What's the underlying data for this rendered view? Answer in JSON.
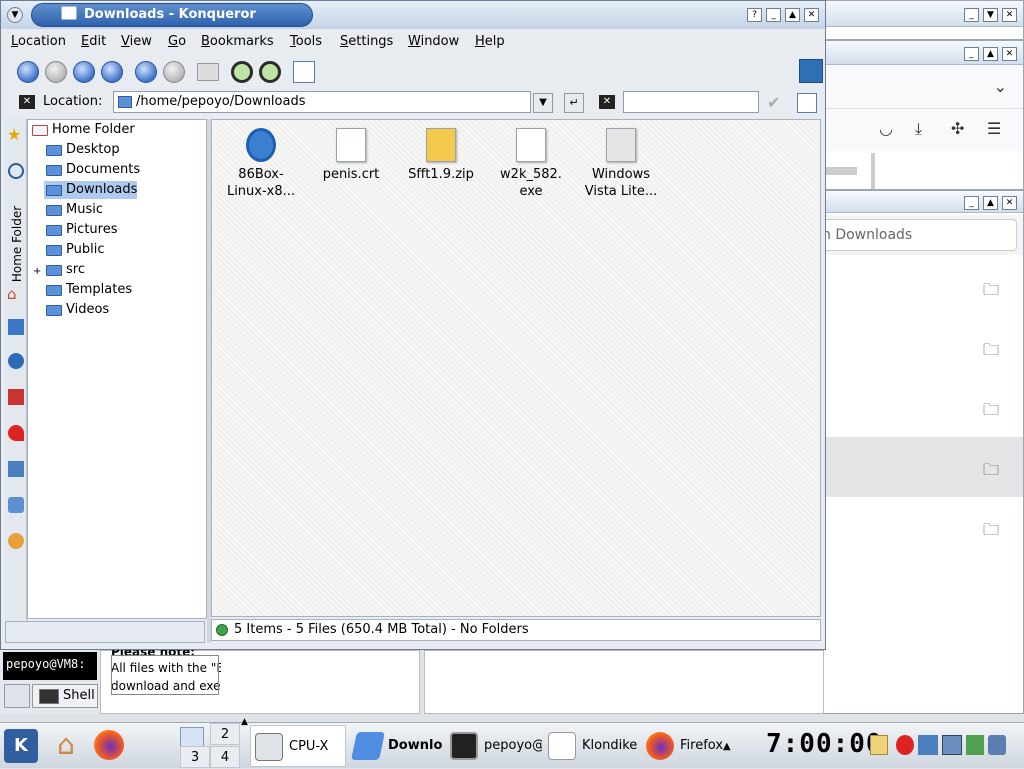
{
  "konqueror": {
    "title": "Downloads - Konqueror",
    "menu": [
      "Location",
      "Edit",
      "View",
      "Go",
      "Bookmarks",
      "Tools",
      "Settings",
      "Window",
      "Help"
    ],
    "location_label": "Location:",
    "location_value": "/home/pepoyo/Downloads",
    "sidebar_tab": "Home Folder",
    "tree": [
      {
        "label": "Home Folder",
        "selected": false
      },
      {
        "label": "Desktop",
        "selected": false
      },
      {
        "label": "Documents",
        "selected": false
      },
      {
        "label": "Downloads",
        "selected": true
      },
      {
        "label": "Music",
        "selected": false
      },
      {
        "label": "Pictures",
        "selected": false
      },
      {
        "label": "Public",
        "selected": false
      },
      {
        "label": "src",
        "selected": false
      },
      {
        "label": "Templates",
        "selected": false
      },
      {
        "label": "Videos",
        "selected": false
      }
    ],
    "files": [
      {
        "name_line1": "86Box-",
        "name_line2": "Linux-x8..."
      },
      {
        "name_line1": "penis.crt",
        "name_line2": ""
      },
      {
        "name_line1": "Sfft1.9.zip",
        "name_line2": ""
      },
      {
        "name_line1": "w2k_582.",
        "name_line2": "exe"
      },
      {
        "name_line1": "Windows",
        "name_line2": "Vista Lite..."
      }
    ],
    "status": "5 Items - 5 Files (650.4 MB Total) - No Folders"
  },
  "background": {
    "firefox_search_placeholder": "h Downloads",
    "terminal_prompt": "pepoyo@VM8:",
    "shell_tab": "Shell",
    "note_title": "Please note:",
    "note_line1": "All files with the \"E",
    "note_line2": "download and exe"
  },
  "taskbar": {
    "pager": [
      "2",
      "3",
      "4"
    ],
    "tasks": [
      {
        "label": "CPU-X"
      },
      {
        "label": "Downlo"
      },
      {
        "label": "pepoyo@"
      },
      {
        "label": "Klondike"
      },
      {
        "label": "Firefox"
      }
    ],
    "clock": "7:00:00"
  },
  "colors": {
    "title_pill": "#2f62ad",
    "selection": "#aecbef",
    "folder": "#5a91d8"
  }
}
